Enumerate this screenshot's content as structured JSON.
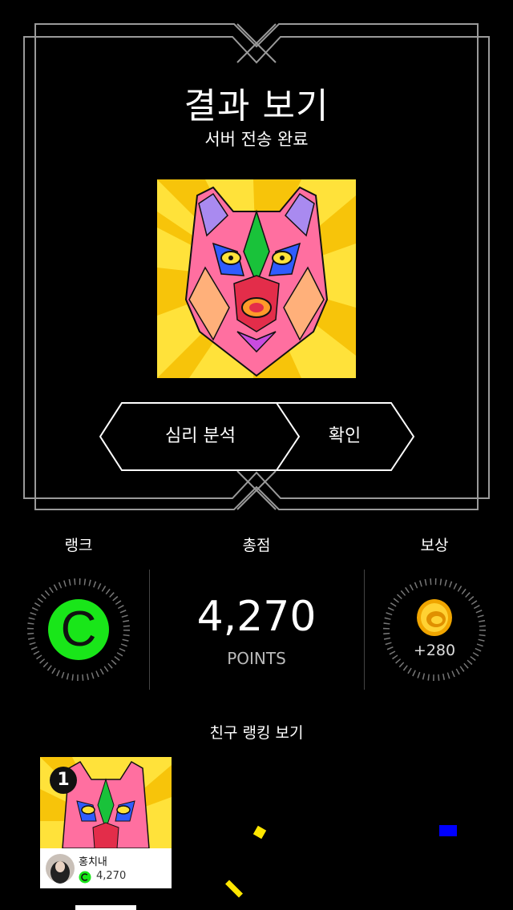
{
  "result": {
    "title": "결과 보기",
    "subtitle": "서버 전송 완료",
    "art_icon": "wolf-mosaic-art"
  },
  "buttons": {
    "analysis_label": "심리 분석",
    "confirm_label": "확인"
  },
  "stats": {
    "rank_label": "랭크",
    "rank_value": "C",
    "score_label": "총점",
    "score_value": "4,270",
    "score_unit": "POINTS",
    "reward_label": "보상",
    "reward_value": "+280",
    "reward_icon": "gold-coin-icon"
  },
  "friends": {
    "title": "친구 랭킹 보기",
    "items": [
      {
        "rank": "1",
        "name": "홍치내",
        "score": "4,270"
      }
    ]
  },
  "colors": {
    "background": "#000000",
    "rank_green": "#19e619",
    "coin_gold": "#f5b800",
    "frame_line": "#9a9a9a"
  }
}
